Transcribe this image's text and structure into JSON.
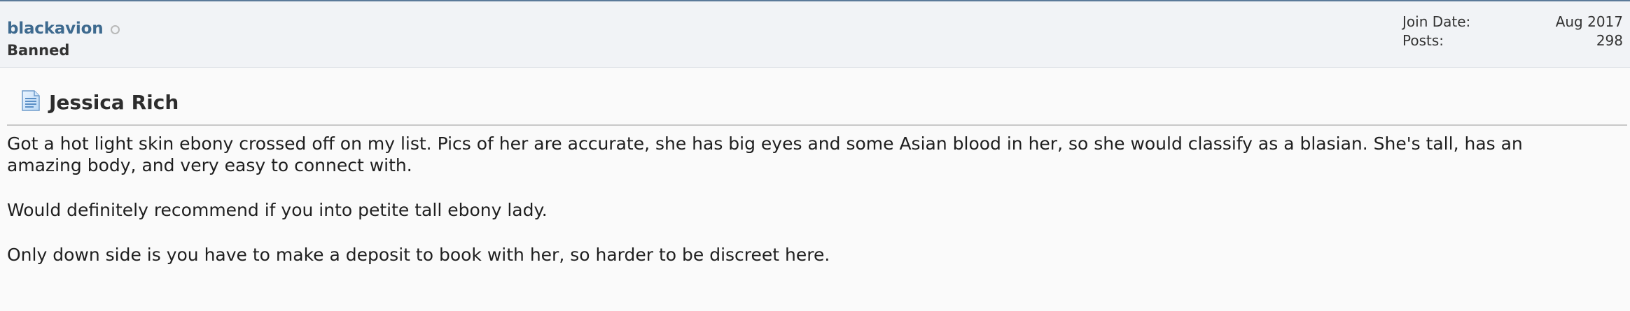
{
  "user": {
    "username": "blackavion",
    "title": "Banned",
    "status_icon": "offline-status-icon",
    "stats": [
      {
        "label": "Join Date:",
        "value": "Aug 2017"
      },
      {
        "label": "Posts:",
        "value": "298"
      }
    ]
  },
  "post": {
    "icon": "document-icon",
    "title": "Jessica Rich",
    "paragraphs": [
      "Got a hot light skin ebony crossed off on my list. Pics of her are accurate, she has big eyes and some Asian blood in her, so she would classify as a blasian. She's tall, has an amazing body, and very easy to connect with.",
      "Would definitely recommend if you into petite tall ebony lady.",
      "Only down side is you have to make a deposit to book with her, so harder to be discreet here."
    ]
  },
  "colors": {
    "username": "#3e6a8f",
    "top_border": "#5b7a99",
    "header_bg": "#f1f3f6",
    "body_bg": "#fafafa"
  }
}
